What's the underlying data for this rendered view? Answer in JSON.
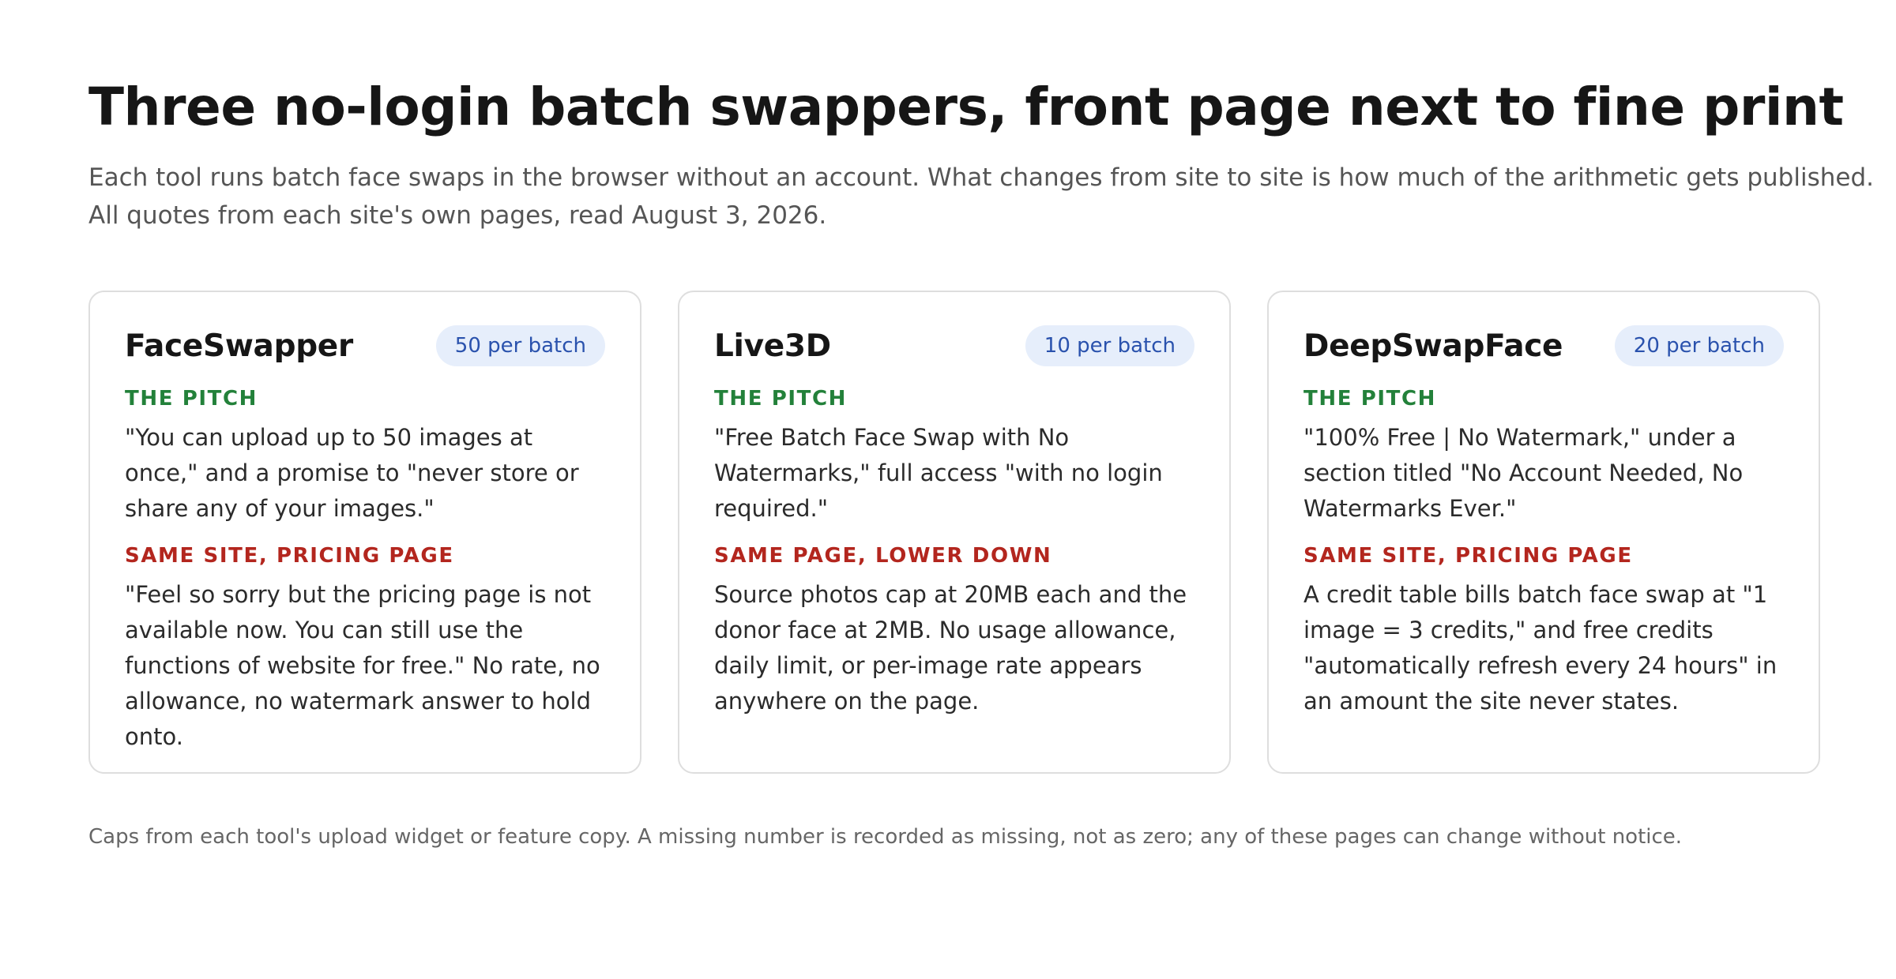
{
  "header": {
    "title": "Three no-login batch swappers, front page next to fine print",
    "subtitle_line_1": "Each tool runs batch face swaps in the browser without an account. What changes from site to site is how much of the arithmetic gets published.",
    "subtitle_line_2": "All quotes from each site's own pages, read August 3, 2026."
  },
  "cards": [
    {
      "name": "FaceSwapper",
      "badge": "50 per batch",
      "pitch_label": "THE PITCH",
      "pitch_text": "\"You can upload up to 50 images at once,\" and a promise to \"never store or share any of your images.\"",
      "fine_label": "SAME SITE, PRICING PAGE",
      "fine_text": "\"Feel so sorry but the pricing page is not available now. You can still use the functions of website for free.\" No rate, no allowance, no watermark answer to hold onto."
    },
    {
      "name": "Live3D",
      "badge": "10 per batch",
      "pitch_label": "THE PITCH",
      "pitch_text": "\"Free Batch Face Swap with No Watermarks,\" full access \"with no login required.\"",
      "fine_label": "SAME PAGE, LOWER DOWN",
      "fine_text": "Source photos cap at 20MB each and the donor face at 2MB. No usage allowance, daily limit, or per-image rate appears anywhere on the page."
    },
    {
      "name": "DeepSwapFace",
      "badge": "20 per batch",
      "pitch_label": "THE PITCH",
      "pitch_text": "\"100% Free | No Watermark,\" under a section titled \"No Account Needed, No Watermarks Ever.\"",
      "fine_label": "SAME SITE, PRICING PAGE",
      "fine_text": "A credit table bills batch face swap at \"1 image = 3 credits,\" and free credits \"automatically refresh every 24 hours\" in an amount the site never states."
    }
  ],
  "footnote": "Caps from each tool's upload widget or feature copy. A missing number is recorded as missing, not as zero; any of these pages can change without notice.",
  "colors": {
    "pitch_label": "#23813a",
    "fine_label": "#b3261e",
    "badge_background": "#e6eefb",
    "badge_text": "#2a52ad"
  }
}
